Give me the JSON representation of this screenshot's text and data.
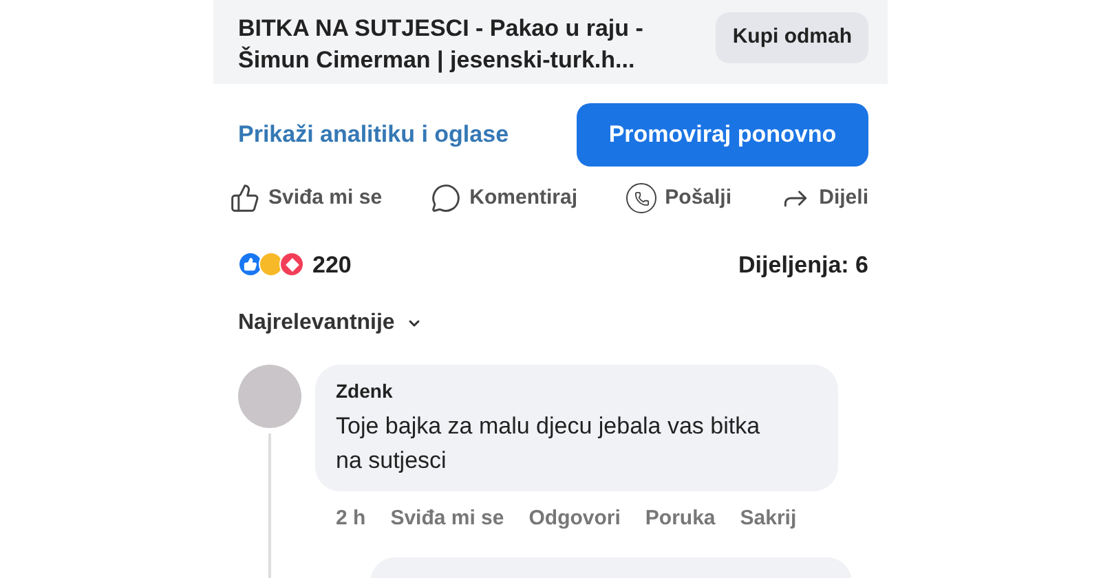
{
  "link_preview": {
    "title": "BITKA NA SUTJESCI - Pakao u raju - Šimun Cimerman | jesenski-turk.h...",
    "button": "Kupi odmah"
  },
  "analytics_link": "Prikaži analitiku i oglase",
  "promote_button": "Promoviraj ponovno",
  "actions": [
    {
      "kind": "like",
      "label": "Sviđa mi se"
    },
    {
      "kind": "comment",
      "label": "Komentiraj"
    },
    {
      "kind": "whatsapp",
      "label": "Pošalji"
    },
    {
      "kind": "share",
      "label": "Dijeli"
    }
  ],
  "reactions": {
    "count": "220",
    "shares": "Dijeljenja: 6"
  },
  "sort": "Najrelevantnije",
  "comment": {
    "author": "Zdenk",
    "text": "Toje bajka za malu djecu jebala vas bitka na sutjesci",
    "time": "2 h",
    "actions": [
      "Sviđa mi se",
      "Odgovori",
      "Poruka",
      "Sakrij"
    ]
  }
}
